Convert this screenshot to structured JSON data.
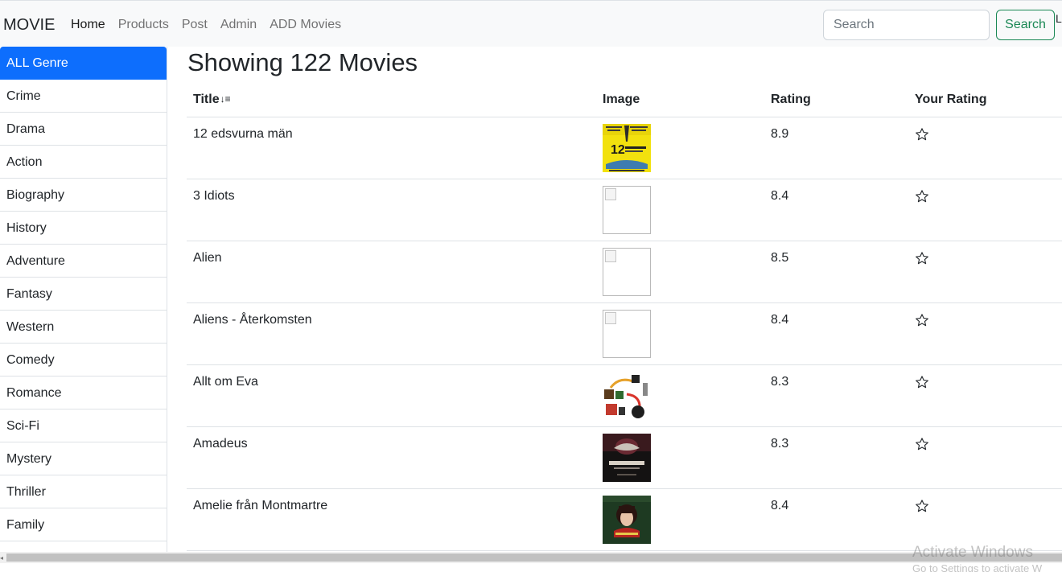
{
  "navbar": {
    "brand": "MOVIE",
    "links": [
      "Home",
      "Products",
      "Post",
      "Admin",
      "ADD Movies"
    ],
    "search_placeholder": "Search",
    "search_button": "Search",
    "overflow_text": "L"
  },
  "sidebar": {
    "genres": [
      "ALL Genre",
      "Crime",
      "Drama",
      "Action",
      "Biography",
      "History",
      "Adventure",
      "Fantasy",
      "Western",
      "Comedy",
      "Romance",
      "Sci-Fi",
      "Mystery",
      "Thriller",
      "Family"
    ]
  },
  "main": {
    "heading": "Showing 122 Movies",
    "columns": {
      "title": "Title",
      "sort_glyph": "↓≡",
      "image": "Image",
      "rating": "Rating",
      "your_rating": "Your Rating"
    },
    "movies": [
      {
        "title": "12 edsvurna män",
        "rating": "8.9",
        "image": "poster-12-angry-men"
      },
      {
        "title": "3 Idiots",
        "rating": "8.4",
        "image": "broken-image"
      },
      {
        "title": "Alien",
        "rating": "8.5",
        "image": "broken-image"
      },
      {
        "title": "Aliens - Återkomsten",
        "rating": "8.4",
        "image": "broken-image"
      },
      {
        "title": "Allt om Eva",
        "rating": "8.3",
        "image": "poster-all-about-eve"
      },
      {
        "title": "Amadeus",
        "rating": "8.3",
        "image": "poster-amadeus"
      },
      {
        "title": "Amelie från Montmartre",
        "rating": "8.4",
        "image": "poster-amelie"
      }
    ]
  },
  "watermark": {
    "line1": "Activate Windows",
    "line2": "Go to Settings to activate W"
  },
  "colors": {
    "primary": "#0d6efd",
    "success": "#198754",
    "navbar_bg": "#f8f9fa"
  }
}
